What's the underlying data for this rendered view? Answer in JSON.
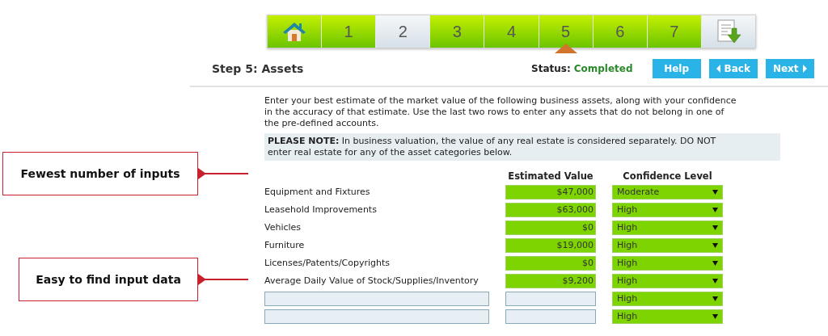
{
  "steps": [
    {
      "kind": "home",
      "filled": true,
      "selected": false
    },
    {
      "kind": "number",
      "label": "1",
      "filled": true,
      "selected": false
    },
    {
      "kind": "number",
      "label": "2",
      "filled": false,
      "selected": false
    },
    {
      "kind": "number",
      "label": "3",
      "filled": true,
      "selected": false
    },
    {
      "kind": "number",
      "label": "4",
      "filled": true,
      "selected": false
    },
    {
      "kind": "number",
      "label": "5",
      "filled": true,
      "selected": true
    },
    {
      "kind": "number",
      "label": "6",
      "filled": true,
      "selected": false
    },
    {
      "kind": "number",
      "label": "7",
      "filled": true,
      "selected": false
    },
    {
      "kind": "download",
      "filled": false,
      "selected": false
    }
  ],
  "heading": "Step 5: Assets",
  "status": {
    "label": "Status:",
    "value": "Completed"
  },
  "buttons": [
    {
      "kind": "plain",
      "label": "Help"
    },
    {
      "kind": "back",
      "label": "Back"
    },
    {
      "kind": "next",
      "label": "Next"
    }
  ],
  "intro": "Enter your best estimate of the market value of the following business assets, along with your confidence in the accuracy of that estimate. Use the last two rows to enter any assets that do not belong in one of the pre-defined accounts.",
  "note": "**PLEASE NOTE:** In business valuation, the value of any real estate is considered separately. DO NOT enter real estate for any of the asset categories below.",
  "columns": [
    "Estimated Value",
    "Confidence Level"
  ],
  "rows": [
    {
      "kind": "asset",
      "label": "Equipment and Fixtures",
      "value": "$47,000",
      "confidence": "Moderate"
    },
    {
      "kind": "asset",
      "label": "Leasehold Improvements",
      "value": "$63,000",
      "confidence": "High"
    },
    {
      "kind": "asset",
      "label": "Vehicles",
      "value": "$0",
      "confidence": "High"
    },
    {
      "kind": "asset",
      "label": "Furniture",
      "value": "$19,000",
      "confidence": "High"
    },
    {
      "kind": "asset",
      "label": "Licenses/Patents/Copyrights",
      "value": "$0",
      "confidence": "High"
    },
    {
      "kind": "asset",
      "label": "Average Daily Value of Stock/Supplies/Inventory",
      "value": "$9,200",
      "confidence": "High"
    },
    {
      "kind": "custom",
      "confidence": "High"
    },
    {
      "kind": "custom",
      "confidence": "High"
    }
  ],
  "callouts": [
    "Fewest number of inputs",
    "Easy to find input data"
  ]
}
